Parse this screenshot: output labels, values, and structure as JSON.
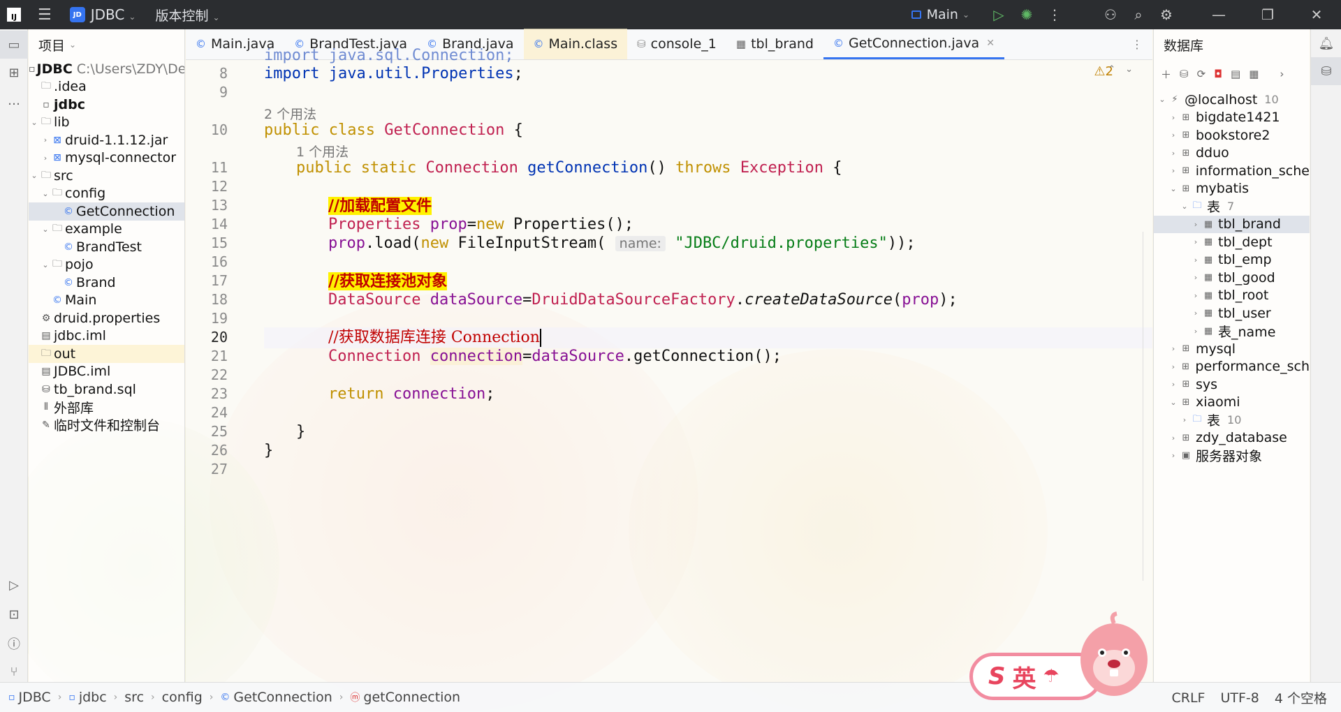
{
  "titlebar": {
    "logo": "IJ",
    "project_badge": "JD",
    "project_name": "JDBC",
    "vcs_label": "版本控制",
    "run_config": "Main"
  },
  "project_panel": {
    "title": "项目",
    "tree": [
      {
        "label": "JDBC",
        "path": "C:\\Users\\ZDY\\De",
        "icon": "module-icon",
        "depth": 0,
        "arrow": "",
        "bold": true
      },
      {
        "label": ".idea",
        "icon": "folder-icon",
        "depth": 0,
        "arrow": ""
      },
      {
        "label": "jdbc",
        "icon": "module-icon",
        "depth": 0,
        "arrow": "",
        "bold": true
      },
      {
        "label": "lib",
        "icon": "folder-icon",
        "depth": 0,
        "arrow": "v"
      },
      {
        "label": "druid-1.1.12.jar",
        "icon": "jar-icon",
        "depth": 1,
        "arrow": ">"
      },
      {
        "label": "mysql-connector",
        "icon": "jar-icon",
        "depth": 1,
        "arrow": ">"
      },
      {
        "label": "src",
        "icon": "folder-icon",
        "depth": 0,
        "arrow": "v"
      },
      {
        "label": "config",
        "icon": "package-icon",
        "depth": 1,
        "arrow": "v"
      },
      {
        "label": "GetConnection",
        "icon": "class-icon",
        "depth": 2,
        "arrow": "",
        "selected": true
      },
      {
        "label": "example",
        "icon": "package-icon",
        "depth": 1,
        "arrow": "v"
      },
      {
        "label": "BrandTest",
        "icon": "class-icon",
        "depth": 2,
        "arrow": ""
      },
      {
        "label": "pojo",
        "icon": "package-icon",
        "depth": 1,
        "arrow": "v"
      },
      {
        "label": "Brand",
        "icon": "class-icon",
        "depth": 2,
        "arrow": ""
      },
      {
        "label": "Main",
        "icon": "class-icon",
        "depth": 1,
        "arrow": ""
      },
      {
        "label": "druid.properties",
        "icon": "properties-icon",
        "depth": 0,
        "arrow": ""
      },
      {
        "label": "jdbc.iml",
        "icon": "iml-icon",
        "depth": 0,
        "arrow": ""
      },
      {
        "label": "out",
        "icon": "folder-icon",
        "depth": 0,
        "arrow": "",
        "out": true
      },
      {
        "label": "JDBC.iml",
        "icon": "iml-icon",
        "depth": 0,
        "arrow": ""
      },
      {
        "label": "tb_brand.sql",
        "icon": "sql-icon",
        "depth": 0,
        "arrow": ""
      },
      {
        "label": "外部库",
        "icon": "library-icon",
        "depth": 0,
        "arrow": ""
      },
      {
        "label": "临时文件和控制台",
        "icon": "scratch-icon",
        "depth": 0,
        "arrow": ""
      }
    ]
  },
  "tabs": [
    {
      "label": "Main.java",
      "icon": "class-icon"
    },
    {
      "label": "BrandTest.java",
      "icon": "class-icon"
    },
    {
      "label": "Brand.java",
      "icon": "class-icon"
    },
    {
      "label": "Main.class",
      "icon": "class-icon",
      "mainclass": true
    },
    {
      "label": "console_1",
      "icon": "sql-icon"
    },
    {
      "label": "tbl_brand",
      "icon": "table-icon"
    },
    {
      "label": "GetConnection.java",
      "icon": "class-icon",
      "active": true
    }
  ],
  "editor": {
    "warnings": "2",
    "line_numbers": [
      "8",
      "9",
      "10",
      "11",
      "12",
      "13",
      "14",
      "15",
      "16",
      "17",
      "18",
      "19",
      "20",
      "21",
      "22",
      "23",
      "24",
      "25",
      "26",
      "27"
    ],
    "current_line": "20",
    "usage_hint_class": "2 个用法",
    "usage_hint_method": "1 个用法",
    "code": {
      "l7_partial": "import java.sql.Connection;",
      "l8_kw": "import",
      "l8_pkg": "java.util.Properties",
      "l10_mods": "public class",
      "l10_name": "GetConnection",
      "l11_mods": "public static",
      "l11_type": "Connection",
      "l11_name": "getConnection",
      "l11_throws": "throws",
      "l11_exc": "Exception",
      "l13_comment": "//加载配置文件",
      "l14_type": "Properties",
      "l14_var": "prop",
      "l14_new": "new",
      "l14_ctor": "Properties",
      "l15_var": "prop",
      "l15_call": "load",
      "l15_new": "new",
      "l15_ctor": "FileInputStream",
      "l15_hint": "name:",
      "l15_str": "\"JDBC/druid.properties\"",
      "l17_comment": "//获取连接池对象",
      "l18_type": "DataSource",
      "l18_var": "dataSource",
      "l18_factory": "DruidDataSourceFactory",
      "l18_method": "createDataSource",
      "l18_arg": "prop",
      "l20_comment": "//获取数据库连接 Connection",
      "l21_type": "Connection",
      "l21_var": "connection",
      "l21_src": "dataSource",
      "l21_call": "getConnection",
      "l23_kw": "return",
      "l23_var": "connection"
    }
  },
  "db_panel": {
    "title": "数据库",
    "tree": [
      {
        "label": "@localhost",
        "count": "10",
        "icon": "datasource-icon",
        "depth": 0,
        "arrow": "v"
      },
      {
        "label": "bigdate1421",
        "icon": "schema-icon",
        "depth": 1,
        "arrow": ">"
      },
      {
        "label": "bookstore2",
        "icon": "schema-icon",
        "depth": 1,
        "arrow": ">"
      },
      {
        "label": "dduo",
        "icon": "schema-icon",
        "depth": 1,
        "arrow": ">"
      },
      {
        "label": "information_sche",
        "icon": "schema-icon",
        "depth": 1,
        "arrow": ">"
      },
      {
        "label": "mybatis",
        "icon": "schema-icon",
        "depth": 1,
        "arrow": "v"
      },
      {
        "label": "表",
        "count": "7",
        "icon": "folder-icon",
        "depth": 2,
        "arrow": "v"
      },
      {
        "label": "tbl_brand",
        "icon": "table-icon",
        "depth": 3,
        "arrow": ">",
        "selected": true
      },
      {
        "label": "tbl_dept",
        "icon": "table-icon",
        "depth": 3,
        "arrow": ">"
      },
      {
        "label": "tbl_emp",
        "icon": "table-icon",
        "depth": 3,
        "arrow": ">"
      },
      {
        "label": "tbl_good",
        "icon": "table-icon",
        "depth": 3,
        "arrow": ">"
      },
      {
        "label": "tbl_root",
        "icon": "table-icon",
        "depth": 3,
        "arrow": ">"
      },
      {
        "label": "tbl_user",
        "icon": "table-icon",
        "depth": 3,
        "arrow": ">"
      },
      {
        "label": "表_name",
        "icon": "table-icon",
        "depth": 3,
        "arrow": ">"
      },
      {
        "label": "mysql",
        "icon": "schema-icon",
        "depth": 1,
        "arrow": ">"
      },
      {
        "label": "performance_sch",
        "icon": "schema-icon",
        "depth": 1,
        "arrow": ">"
      },
      {
        "label": "sys",
        "icon": "schema-icon",
        "depth": 1,
        "arrow": ">"
      },
      {
        "label": "xiaomi",
        "icon": "schema-icon",
        "depth": 1,
        "arrow": "v"
      },
      {
        "label": "表",
        "count": "10",
        "icon": "folder-icon",
        "depth": 2,
        "arrow": ">"
      },
      {
        "label": "zdy_database",
        "icon": "schema-icon",
        "depth": 1,
        "arrow": ">"
      },
      {
        "label": "服务器对象",
        "icon": "server-objects-icon",
        "depth": 1,
        "arrow": ">"
      }
    ]
  },
  "statusbar": {
    "breadcrumbs": [
      {
        "label": "JDBC",
        "icon": "module-icon"
      },
      {
        "label": "jdbc",
        "icon": "module-icon"
      },
      {
        "label": "src",
        "icon": ""
      },
      {
        "label": "config",
        "icon": ""
      },
      {
        "label": "GetConnection",
        "icon": "class-icon"
      },
      {
        "label": "getConnection",
        "icon": "method-icon"
      }
    ],
    "line_sep": "CRLF",
    "encoding": "UTF-8",
    "indent": "4 个空格"
  },
  "ime": {
    "logo_letter": "S",
    "mode": "英"
  },
  "colors": {
    "accent": "#3574f0",
    "keyword": "#0033b3",
    "comment_highlight": "#fff200",
    "comment_text": "#c00000",
    "string": "#067d17"
  }
}
